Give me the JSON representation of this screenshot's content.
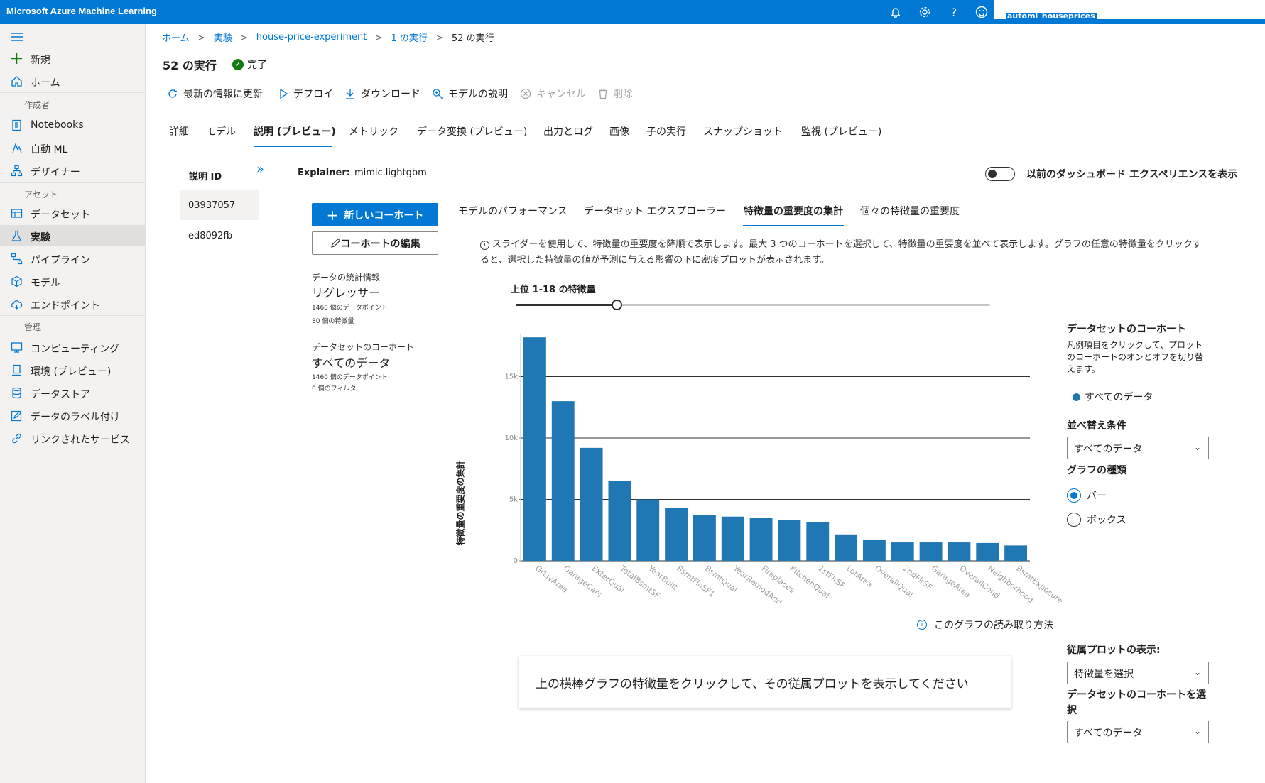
{
  "topbar": {
    "title": "Microsoft Azure Machine Learning",
    "account": "automl_houseprices"
  },
  "sidebar": {
    "new": "新規",
    "home": "ホーム",
    "section_author": "作成者",
    "notebooks": "Notebooks",
    "automl": "自動 ML",
    "designer": "デザイナー",
    "section_assets": "アセット",
    "datasets": "データセット",
    "experiments": "実験",
    "pipelines": "パイプライン",
    "models": "モデル",
    "endpoints": "エンドポイント",
    "section_manage": "管理",
    "compute": "コンピューティング",
    "environments": "環境 (プレビュー)",
    "datastores": "データストア",
    "labeling": "データのラベル付け",
    "linked": "リンクされたサービス"
  },
  "breadcrumb": [
    "ホーム",
    "実験",
    "house-price-experiment",
    "1 の実行",
    "52 の実行"
  ],
  "page": {
    "title": "52 の実行",
    "status": "完了"
  },
  "toolbar": {
    "refresh": "最新の情報に更新",
    "deploy": "デプロイ",
    "download": "ダウンロード",
    "explain": "モデルの説明",
    "cancel": "キャンセル",
    "delete": "削除"
  },
  "tabs": [
    "詳細",
    "モデル",
    "説明 (プレビュー)",
    "メトリック",
    "データ変換 (プレビュー)",
    "出力とログ",
    "画像",
    "子の実行",
    "スナップショット",
    "監視 (プレビュー)"
  ],
  "explanations": {
    "header": "説明 ID",
    "ids": [
      "03937057",
      "ed8092fb"
    ]
  },
  "explainer": {
    "label": "Explainer:",
    "value": "mimic.lightgbm"
  },
  "toggle": {
    "label": "以前のダッシュボード エクスペリエンスを表示",
    "on": false
  },
  "cohort_panel": {
    "new_cohort": "新しいコーホート",
    "edit_cohort": "コーホートの編集",
    "stats_label": "データの統計情報",
    "stats_value": "リグレッサー",
    "stats_points": "1460 個のデータポイント",
    "stats_features": "80 個の特徴量",
    "cohort_label": "データセットのコーホート",
    "cohort_value": "すべてのデータ",
    "cohort_points": "1460 個のデータポイント",
    "cohort_filters": "0 個のフィルター"
  },
  "subtabs": [
    "モデルのパフォーマンス",
    "データセット エクスプローラー",
    "特徴量の重要度の集計",
    "個々の特徴量の重要度"
  ],
  "description": "スライダーを使用して、特徴量の重要度を降順で表示します。最大 3 つのコーホートを選択して、特徴量の重要度を並べて表示します。グラフの任意の特徴量をクリックすると、選択した特徴量の値が予測に与える影響の下に密度プロットが表示されます。",
  "slider": {
    "label": "上位 1-18 の特徴量",
    "value": 18,
    "max": 84
  },
  "chart_data": {
    "type": "bar",
    "ylabel": "特徴量の重要度の集計",
    "xlabel": "",
    "ylim": [
      0,
      18500
    ],
    "yticks": [
      0,
      5000,
      10000,
      15000
    ],
    "ytick_labels": [
      "0",
      "5k",
      "10k",
      "15k"
    ],
    "color": "#1f77b4",
    "categories": [
      "GrLivArea",
      "GarageCars",
      "ExterQual",
      "TotalBsmtSF",
      "YearBuilt",
      "BsmtFinSF1",
      "BsmtQual",
      "YearRemodAdd",
      "Fireplaces",
      "KitchenQual",
      "1stFlrSF",
      "LotArea",
      "OverallQual",
      "2ndFlrSF",
      "GarageArea",
      "OverallCond",
      "Neighborhood",
      "BsmtExposure"
    ],
    "series": [
      {
        "name": "すべてのデータ",
        "values": [
          18200,
          13000,
          9200,
          6500,
          5000,
          4300,
          3750,
          3600,
          3500,
          3300,
          3150,
          2150,
          1700,
          1500,
          1500,
          1500,
          1450,
          1250
        ]
      }
    ]
  },
  "howto": "このグラフの読み取り方法",
  "dependence_placeholder": "上の横棒グラフの特徴量をクリックして、その従属プロットを表示してください",
  "right_panel": {
    "cohort_title": "データセットのコーホート",
    "cohort_text": "凡例項目をクリックして、プロットのコーホートのオンとオフを切り替えます。",
    "legend_item": "すべてのデータ",
    "sort_label": "並べ替え条件",
    "sort_value": "すべてのデータ",
    "chart_type_label": "グラフの種類",
    "radio_bar": "バー",
    "radio_box": "ボックス",
    "dep_label": "従属プロットの表示:",
    "dep_value": "特徴量を選択",
    "dep_cohort_label": "データセットのコーホートを選択",
    "dep_cohort_value": "すべてのデータ"
  }
}
